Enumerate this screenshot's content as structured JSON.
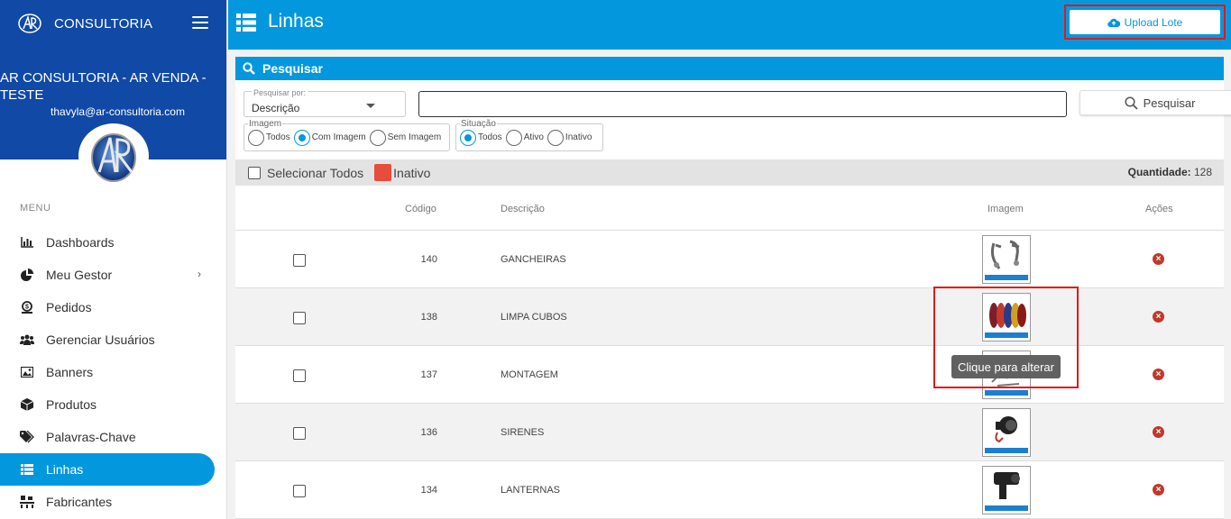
{
  "sidebar": {
    "brand": "CONSULTORIA",
    "company": "AR CONSULTORIA - AR VENDA - TESTE",
    "email": "thavyla@ar-consultoria.com",
    "menu_label": "MENU",
    "items": [
      {
        "label": "Dashboards",
        "icon": "bar-chart-icon"
      },
      {
        "label": "Meu Gestor",
        "icon": "pie-chart-icon"
      },
      {
        "label": "Pedidos",
        "icon": "money-icon"
      },
      {
        "label": "Gerenciar Usuários",
        "icon": "users-icon"
      },
      {
        "label": "Banners",
        "icon": "image-icon"
      },
      {
        "label": "Produtos",
        "icon": "box-icon"
      },
      {
        "label": "Palavras-Chave",
        "icon": "tags-icon"
      },
      {
        "label": "Linhas",
        "icon": "list-icon",
        "active": true
      },
      {
        "label": "Fabricantes",
        "icon": "factory-icon"
      }
    ]
  },
  "header": {
    "title": "Linhas",
    "upload_label": "Upload Lote"
  },
  "search": {
    "title": "Pesquisar",
    "select_label": "Pesquisar por:",
    "select_value": "Descrição",
    "input_value": "",
    "button_label": "Pesquisar",
    "imagem": {
      "legend": "Imagem",
      "options": [
        "Todos",
        "Com Imagem",
        "Sem Imagem"
      ],
      "selected": "Com Imagem"
    },
    "situacao": {
      "legend": "Situação",
      "options": [
        "Todos",
        "Ativo",
        "Inativo"
      ],
      "selected": "Todos"
    }
  },
  "table": {
    "select_all_label": "Selecionar Todos",
    "inactive_legend": "Inativo",
    "quantity_label": "Quantidade:",
    "quantity_value": "128",
    "columns": [
      "Código",
      "Descrição",
      "Imagem",
      "Ações"
    ],
    "rows": [
      {
        "code": "140",
        "description": "GANCHEIRAS",
        "image_caption": "GANCHEIRAS"
      },
      {
        "code": "138",
        "description": "LIMPA CUBOS",
        "image_caption": "LIMPA CUBOS"
      },
      {
        "code": "137",
        "description": "MONTAGEM",
        "image_caption": "MONTAGEM"
      },
      {
        "code": "136",
        "description": "SIRENES",
        "image_caption": "SIRENES"
      },
      {
        "code": "134",
        "description": "LANTERNAS",
        "image_caption": "LANTERNAS"
      }
    ]
  },
  "tooltip": "Clique para alterar",
  "colors": {
    "sidebar_header": "#1049a6",
    "accent": "#0398dd",
    "danger": "#c0392b",
    "inactive": "#e74c3c",
    "highlight": "#e01a1a"
  }
}
